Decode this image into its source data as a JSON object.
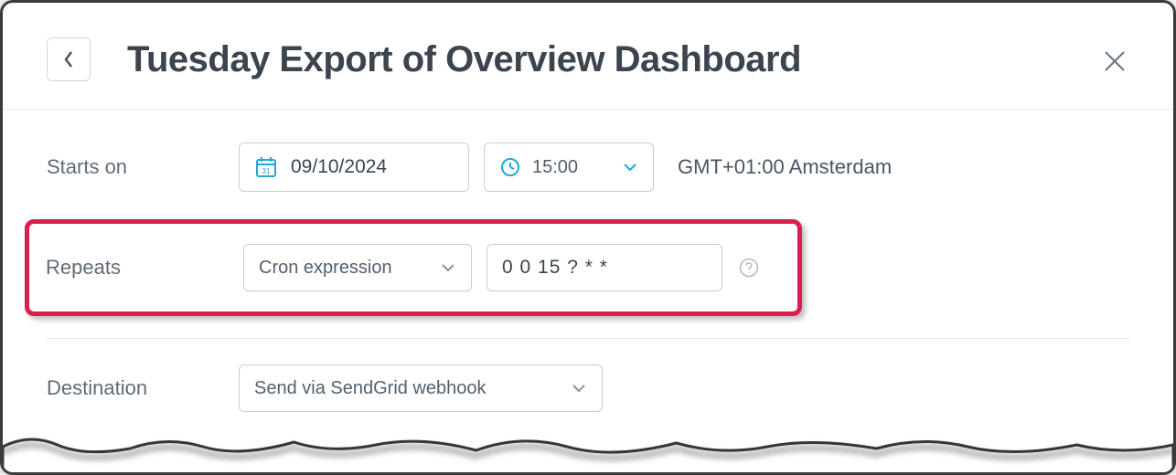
{
  "header": {
    "title": "Tuesday Export of Overview Dashboard"
  },
  "form": {
    "starts_on": {
      "label": "Starts on",
      "date_value": "09/10/2024",
      "time_value": "15:00",
      "timezone": "GMT+01:00 Amsterdam"
    },
    "repeats": {
      "label": "Repeats",
      "type_selected": "Cron expression",
      "cron_value": "0 0 15 ? * *"
    },
    "destination": {
      "label": "Destination",
      "selected": "Send via SendGrid webhook"
    }
  }
}
